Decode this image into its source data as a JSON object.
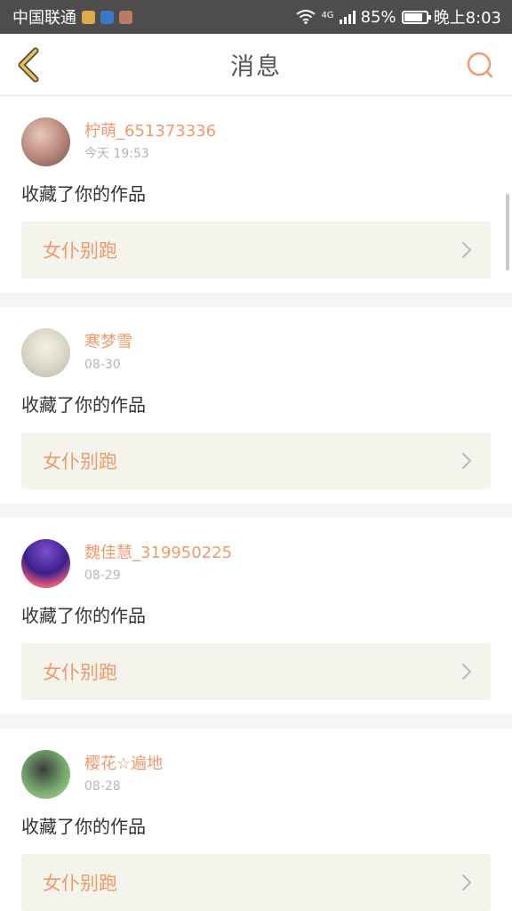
{
  "status_bar": {
    "carrier": "中国联通",
    "network": "4G",
    "battery_percent": "85%",
    "time": "晚上8:03"
  },
  "header": {
    "title": "消息",
    "back_icon": "chevron-left-icon",
    "search_icon": "search-icon"
  },
  "colors": {
    "accent": "#ee9a6c",
    "back_arrow": "#f0c24a",
    "card_bg": "#f4f4ec",
    "divider": "#f6f5f3"
  },
  "messages": [
    {
      "user": "柠萌_651373336",
      "time": "今天 19:53",
      "action": "收藏了你的作品",
      "work": "女仆别跑"
    },
    {
      "user": "寒梦雪",
      "time": "08-30",
      "action": "收藏了你的作品",
      "work": "女仆别跑"
    },
    {
      "user": "魏佳慧_319950225",
      "time": "08-29",
      "action": "收藏了你的作品",
      "work": "女仆别跑"
    },
    {
      "user": "樱花☆遍地",
      "time": "08-28",
      "action": "收藏了你的作品",
      "work": "女仆别跑"
    }
  ]
}
